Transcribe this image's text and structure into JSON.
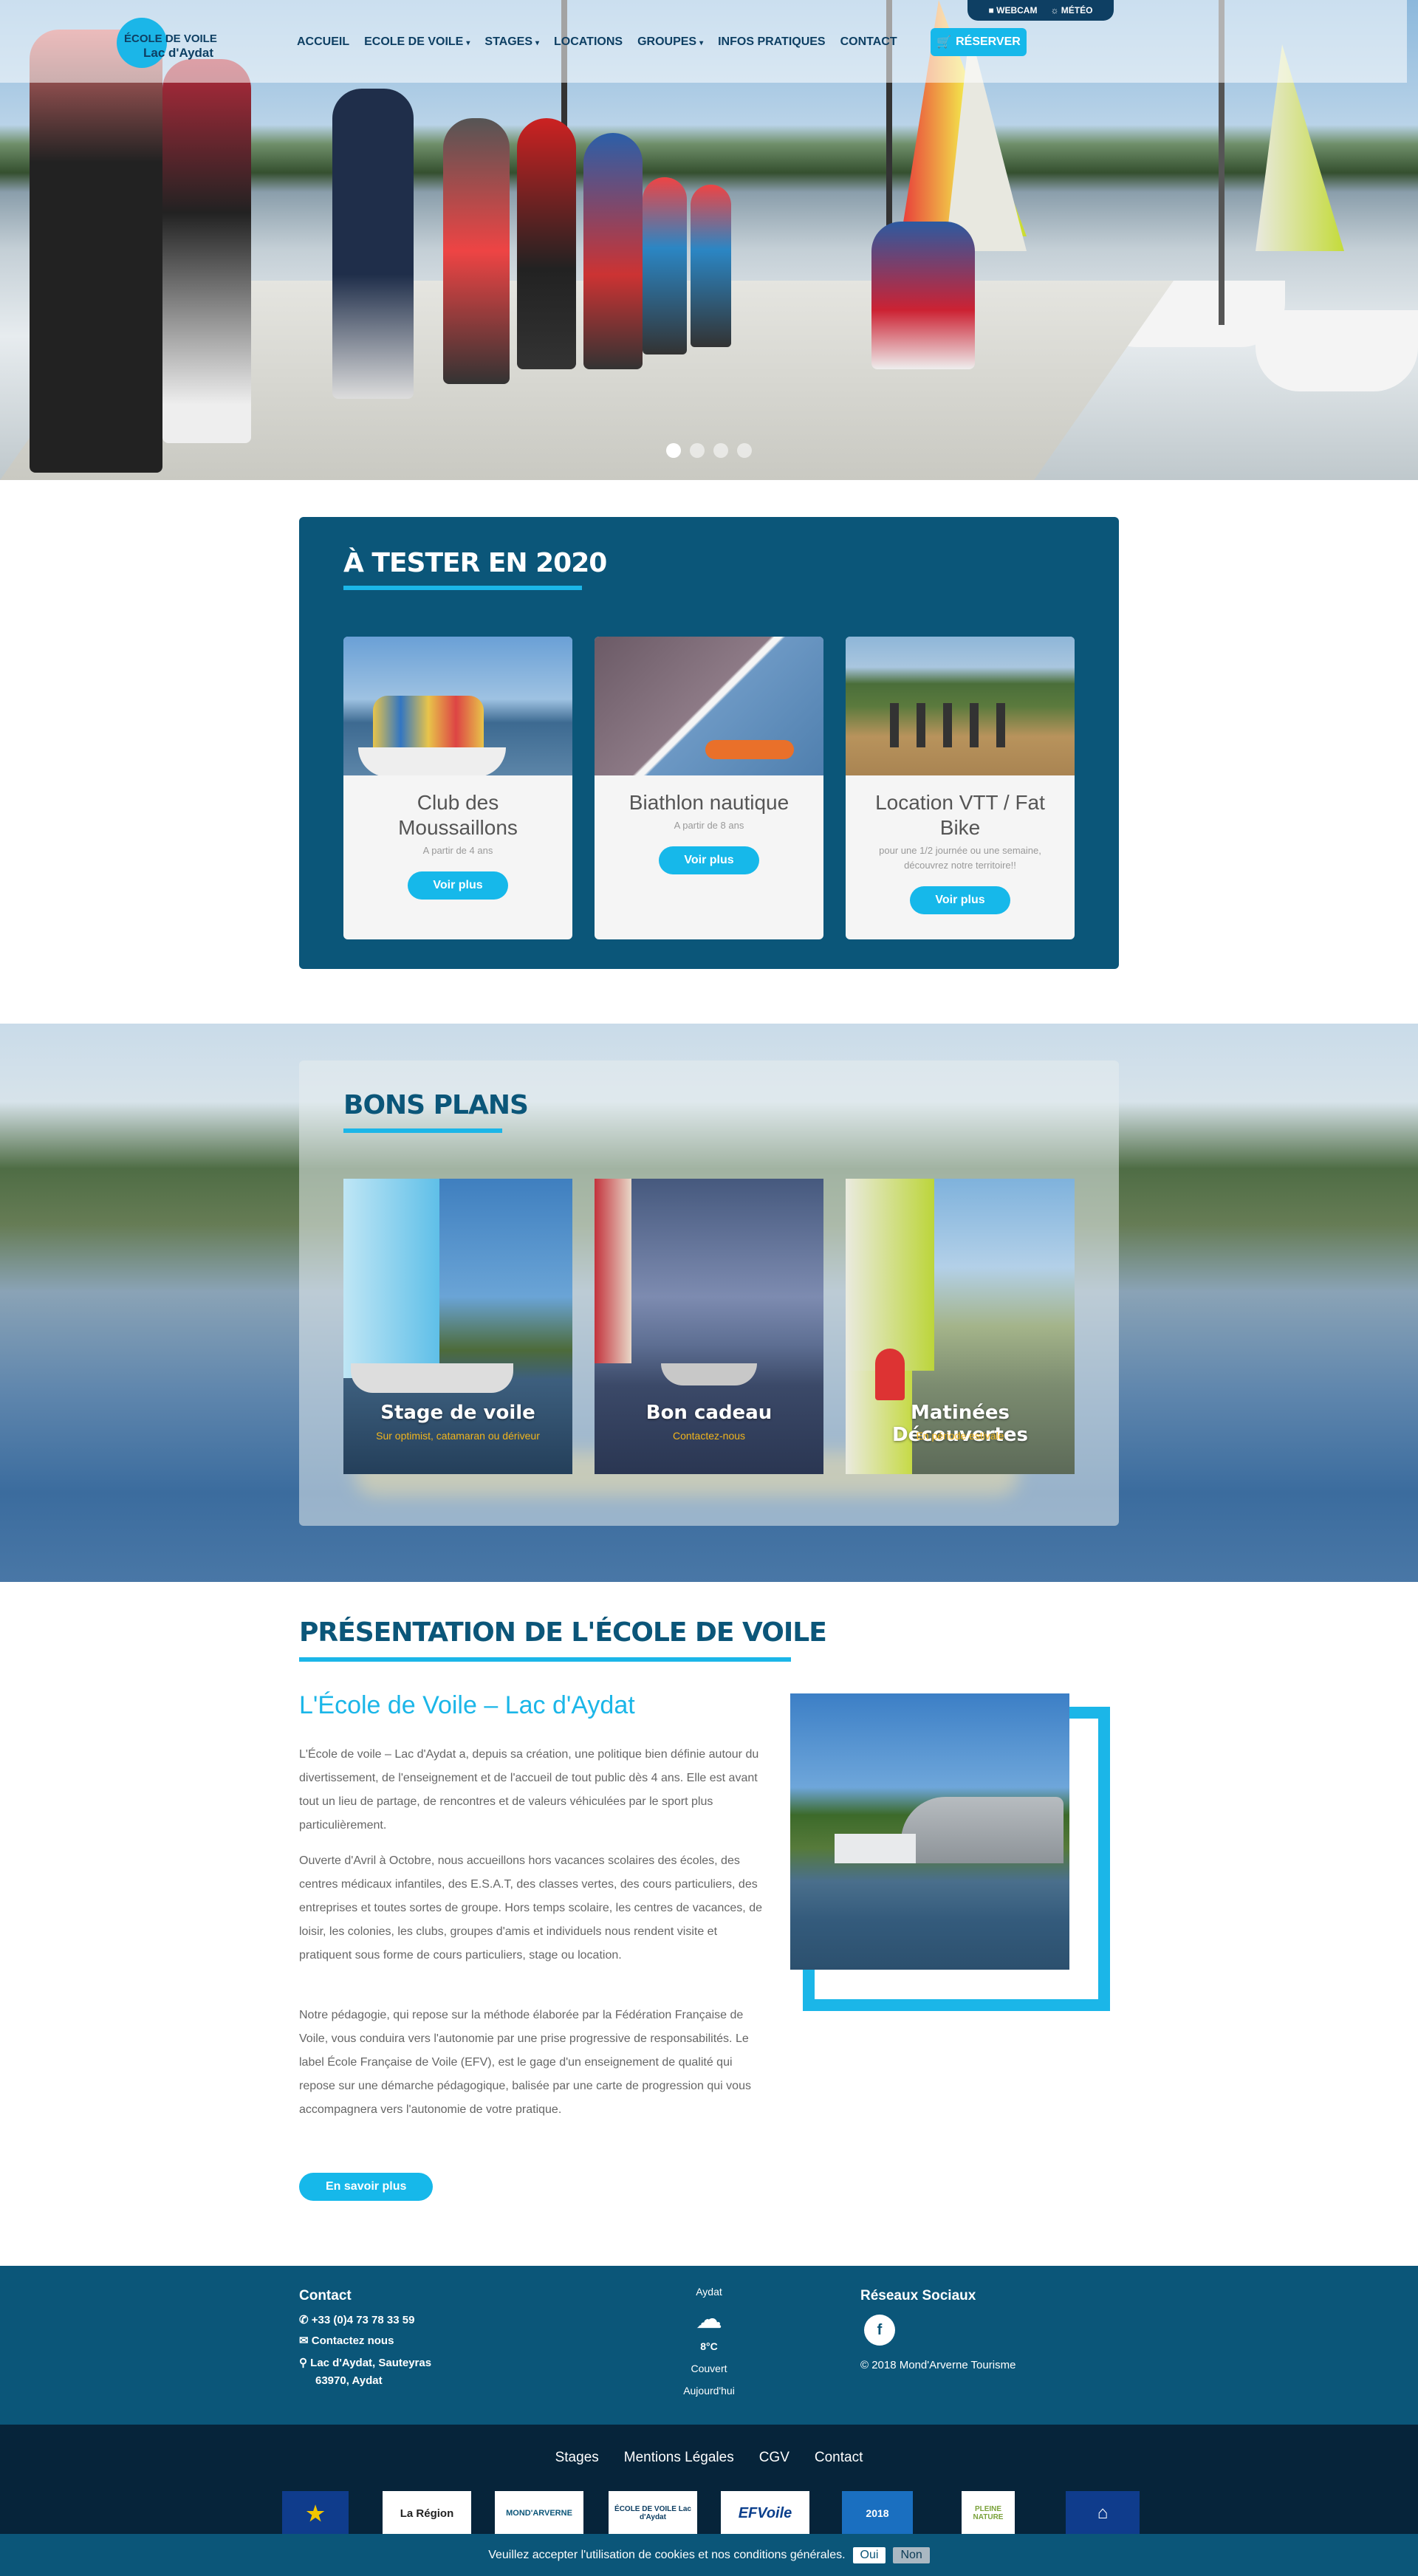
{
  "topbar": {
    "webcam": "WEBCAM",
    "meteo": "MÉTÉO"
  },
  "logo": {
    "line1": "ÉCOLE DE VOILE",
    "line2": "Lac d'Aydat"
  },
  "nav": {
    "items": [
      {
        "label": "ACCUEIL",
        "dropdown": false
      },
      {
        "label": "ECOLE DE VOILE",
        "dropdown": true
      },
      {
        "label": "STAGES",
        "dropdown": true
      },
      {
        "label": "LOCATIONS",
        "dropdown": false
      },
      {
        "label": "GROUPES",
        "dropdown": true
      },
      {
        "label": "INFOS PRATIQUES",
        "dropdown": false
      },
      {
        "label": "CONTACT",
        "dropdown": false
      }
    ],
    "book_label": "RÉSERVER"
  },
  "slider": {
    "count": 4,
    "active_index": 0
  },
  "tester": {
    "title": "À TESTER EN 2020",
    "cards": [
      {
        "title": "Club des Moussaillons",
        "subtitle": "A partir de 4 ans",
        "button": "Voir plus"
      },
      {
        "title": "Biathlon nautique",
        "subtitle": "A partir de 8 ans",
        "button": "Voir plus"
      },
      {
        "title": "Location VTT / Fat Bike",
        "subtitle": "pour une 1/2 journée ou une semaine, découvrez notre territoire!!",
        "button": "Voir plus"
      }
    ]
  },
  "bons_plans": {
    "title": "BONS PLANS",
    "cards": [
      {
        "title": "Stage de voile",
        "subtitle": "Sur optimist, catamaran ou dériveur"
      },
      {
        "title": "Bon cadeau",
        "subtitle": "Contactez-nous"
      },
      {
        "title": "Matinées Découvertes",
        "subtitle": "En période estivale"
      }
    ]
  },
  "presentation": {
    "title": "PRÉSENTATION DE L'ÉCOLE DE VOILE",
    "heading": "L'École de Voile – Lac d'Aydat",
    "paragraphs": [
      "L'École de voile – Lac d'Aydat a, depuis sa création, une politique bien définie autour du divertissement, de l'enseignement et de l'accueil de tout public dès 4 ans. Elle est avant tout un lieu de partage, de rencontres et de valeurs véhiculées par le sport plus particulièrement.",
      "Ouverte d'Avril à Octobre, nous accueillons hors vacances scolaires des écoles, des centres médicaux infantiles, des E.S.A.T, des classes vertes, des cours particuliers, des entreprises et toutes sortes de groupe. Hors temps scolaire, les centres de vacances, de loisir, les colonies, les clubs, groupes d'amis et individuels nous rendent visite et pratiquent sous forme de cours particuliers, stage ou location.",
      "Notre pédagogie, qui repose sur la méthode élaborée par la Fédération Française de Voile, vous conduira vers l'autonomie par une prise progressive de responsabilités. Le label École Française de Voile (EFV), est le gage d'un enseignement de qualité qui repose sur une démarche pédagogique, balisée par une carte de progression qui vous accompagnera vers l'autonomie de votre pratique."
    ],
    "button": "En savoir plus"
  },
  "footer": {
    "contact_title": "Contact",
    "phone": "+33 (0)4 73 78 33 59",
    "contact_link": "Contactez nous",
    "address_line1": "Lac d'Aydat, Sauteyras",
    "address_line2": "63970, Aydat",
    "weather": {
      "place": "Aydat",
      "temp": "8°C",
      "condition": "Couvert",
      "day": "Aujourd'hui"
    },
    "social_title": "Réseaux Sociaux",
    "copyright": "© 2018 Mond'Arverne Tourisme",
    "links": [
      "Stages",
      "Mentions Légales",
      "CGV",
      "Contact"
    ],
    "partners": [
      {
        "label": "★",
        "color": "#0f3c8c"
      },
      {
        "label": "La Région",
        "color": "#ffffff"
      },
      {
        "label": "MOND'ARVERNE",
        "color": "#ffffff"
      },
      {
        "label": "ÉCOLE DE VOILE Lac d'Aydat",
        "color": "#ffffff"
      },
      {
        "label": "EFVoile",
        "color": "#ffffff"
      },
      {
        "label": "2018",
        "color": "#1a6fc0"
      },
      {
        "label": "PLEINE NATURE",
        "color": "#ffffff"
      },
      {
        "label": "⌂",
        "color": "#0f3c8c"
      }
    ]
  },
  "cookie": {
    "text": "Veuillez accepter l'utilisation de cookies et nos conditions générales.",
    "yes": "Oui",
    "no": "Non"
  }
}
